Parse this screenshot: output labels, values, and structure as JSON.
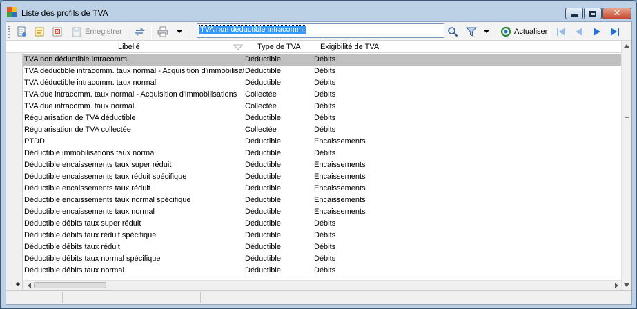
{
  "window": {
    "title": "Liste des profils de TVA"
  },
  "toolbar": {
    "save_label": "Enregistrer",
    "search_value": "TVA non déductible intracomm.",
    "refresh_label": "Actualiser"
  },
  "grid": {
    "columns": [
      "Libellé",
      "Type de TVA",
      "Exigibilité de TVA"
    ],
    "rows": [
      [
        "TVA non déductible intracomm.",
        "Déductible",
        "Débits"
      ],
      [
        "TVA déductible intracomm. taux normal - Acquisition d'immobilisations",
        "Déductible",
        "Débits"
      ],
      [
        "TVA déductible intracomm. taux normal",
        "Déductible",
        "Débits"
      ],
      [
        "TVA due intracomm. taux normal - Acquisition d'immobilisations",
        "Collectée",
        "Débits"
      ],
      [
        "TVA due intracomm. taux normal",
        "Collectée",
        "Débits"
      ],
      [
        "Régularisation de TVA déductible",
        "Déductible",
        "Débits"
      ],
      [
        "Régularisation de TVA collectée",
        "Collectée",
        "Débits"
      ],
      [
        "PTDD",
        "Déductible",
        "Encaissements"
      ],
      [
        "Déductible immobilisations taux normal",
        "Déductible",
        "Débits"
      ],
      [
        "Déductible encaissements taux super réduit",
        "Déductible",
        "Encaissements"
      ],
      [
        "Déductible encaissements taux réduit spécifique",
        "Déductible",
        "Encaissements"
      ],
      [
        "Déductible encaissements taux réduit",
        "Déductible",
        "Encaissements"
      ],
      [
        "Déductible encaissements taux normal spécifique",
        "Déductible",
        "Encaissements"
      ],
      [
        "Déductible encaissements taux normal",
        "Déductible",
        "Encaissements"
      ],
      [
        "Déductible débits taux super réduit",
        "Déductible",
        "Débits"
      ],
      [
        "Déductible débits taux réduit spécifique",
        "Déductible",
        "Débits"
      ],
      [
        "Déductible débits taux réduit",
        "Déductible",
        "Débits"
      ],
      [
        "Déductible débits taux normal spécifique",
        "Déductible",
        "Débits"
      ],
      [
        "Déductible débits taux normal",
        "Déductible",
        "Débits"
      ]
    ],
    "selected_row": 0
  },
  "icons": {
    "toolbar": [
      "new-document-icon",
      "properties-icon",
      "delete-icon",
      "save-icon",
      "sync-icon",
      "print-icon",
      "search-icon",
      "filter-icon",
      "refresh-icon",
      "first-record-icon",
      "previous-record-icon",
      "next-record-icon",
      "last-record-icon"
    ]
  },
  "colors": {
    "selection": "#c0c0c0",
    "search_highlight": "#3399ff",
    "nav_arrows": "#2a6fd1",
    "close_button": "#c44a2c"
  }
}
